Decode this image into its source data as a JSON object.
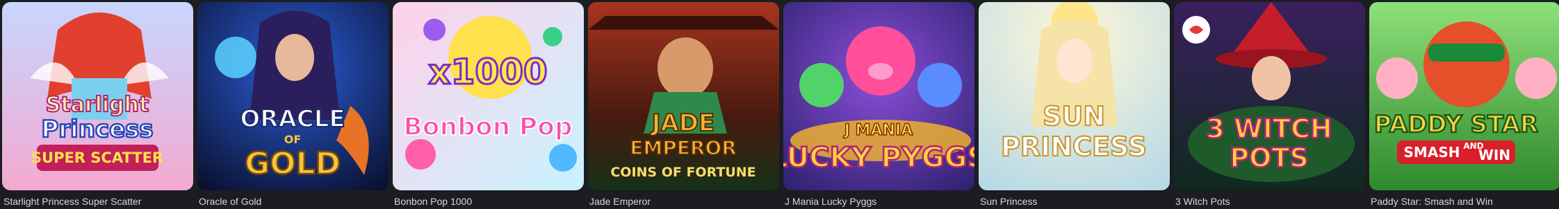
{
  "games": [
    {
      "title": "Starlight Princess Super Scatter",
      "logo_lines": [
        "Starlight",
        "Princess",
        "SUPER SCATTER"
      ],
      "bg": [
        "#f6b8d6",
        "#8fa8e8"
      ],
      "accent": "#ffd84a",
      "icon": "princess-art"
    },
    {
      "title": "Oracle of Gold",
      "logo_lines": [
        "ORACLE",
        "OF",
        "GOLD"
      ],
      "bg": [
        "#0d2a6b",
        "#1a0d33"
      ],
      "accent": "#f5c542",
      "icon": "oracle-art"
    },
    {
      "title": "Bonbon Pop 1000",
      "logo_lines": [
        "x1000",
        "Bonbon Pop"
      ],
      "bg": [
        "#ffc3e1",
        "#b9f0ff"
      ],
      "accent": "#ff4fa8",
      "icon": "candy-art"
    },
    {
      "title": "Jade Emperor",
      "logo_lines": [
        "JADE",
        "EMPEROR",
        "COINS OF FORTUNE"
      ],
      "bg": [
        "#7a1e12",
        "#1f3d22"
      ],
      "accent": "#f2b533",
      "icon": "emperor-art"
    },
    {
      "title": "J Mania Lucky Pyggs",
      "logo_lines": [
        "J MANIA",
        "LUCKY PYGGS"
      ],
      "bg": [
        "#3b2a8c",
        "#7b2fb3"
      ],
      "accent": "#ff5fae",
      "icon": "pigs-art"
    },
    {
      "title": "Sun Princess",
      "logo_lines": [
        "SUN",
        "PRINCESS"
      ],
      "bg": [
        "#fff1c6",
        "#cfe7ef"
      ],
      "accent": "#d9a23a",
      "icon": "sun-princess-art"
    },
    {
      "title": "3 Witch Pots",
      "logo_lines": [
        "3 WITCH",
        "POTS"
      ],
      "bg": [
        "#2a1540",
        "#0f2a1f"
      ],
      "accent": "#ffcf3a",
      "icon": "witch-art"
    },
    {
      "title": "Paddy Star: Smash and Win",
      "logo_lines": [
        "PADDY STAR",
        "SMASH",
        "AND",
        "WIN"
      ],
      "bg": [
        "#7fd36a",
        "#2f8a2c"
      ],
      "accent": "#ffd23a",
      "icon": "paddy-art"
    }
  ]
}
